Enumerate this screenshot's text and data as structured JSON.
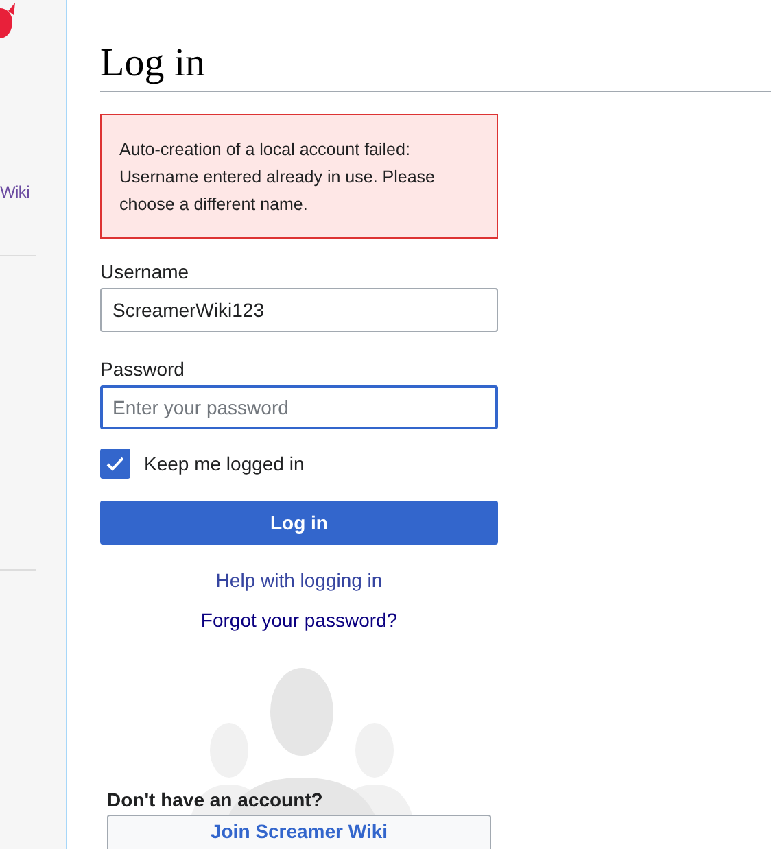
{
  "sidebar": {
    "items": [
      {
        "label": "Wiki"
      }
    ]
  },
  "page": {
    "title": "Log in"
  },
  "error": {
    "message": "Auto-creation of a local account failed: Username entered already in use. Please choose a different name."
  },
  "form": {
    "username": {
      "label": "Username",
      "value": "ScreamerWiki123"
    },
    "password": {
      "label": "Password",
      "placeholder": "Enter your password",
      "focused": true
    },
    "remember": {
      "label": "Keep me logged in",
      "checked": true
    },
    "submit": "Log in",
    "links": [
      "Help with logging in",
      "Forgot your password?"
    ]
  },
  "signup": {
    "prompt": "Don't have an account?",
    "button": "Join Screamer Wiki"
  }
}
